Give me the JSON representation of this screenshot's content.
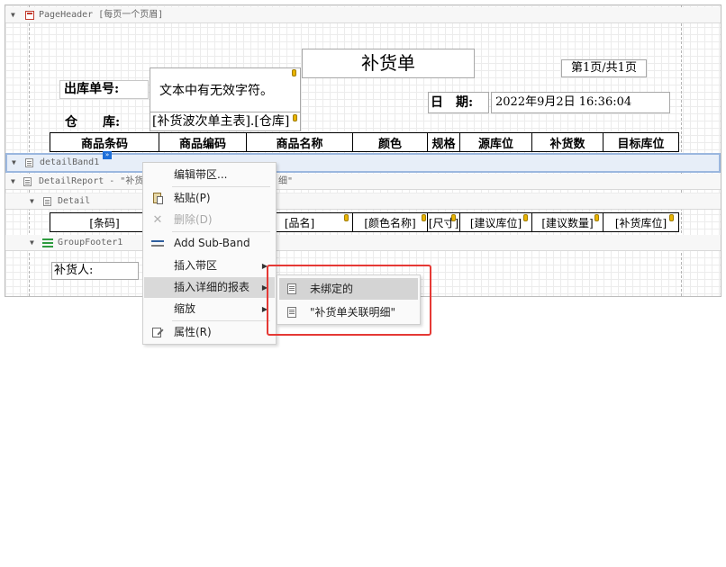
{
  "bands": {
    "page_header": "PageHeader [每页一个页眉]",
    "detail_band": "detailBand1",
    "detail_report": "DetailReport - \"补货单关联明细\"",
    "detail_report_visible": "DetailReport - \"补货",
    "detail_report_tail": "细\"",
    "detail": "Detail",
    "group_footer": "GroupFooter1"
  },
  "page_header": {
    "title": "补货单",
    "page_info": "第1页/共1页",
    "out_no_label": "出库单号:",
    "invalid_text": "文本中有无效字符。",
    "date_label": "日　期:",
    "date_value": "2022年9月2日 16:36:04",
    "warehouse_label": "仓　　库:",
    "warehouse_value": "[补货波次单主表].[仓库]"
  },
  "table_headers": [
    "商品条码",
    "商品编码",
    "商品名称",
    "颜色",
    "规格",
    "源库位",
    "补货数",
    "目标库位"
  ],
  "detail_cells": [
    "[条码]",
    "",
    "[品名]",
    "[颜色名称]",
    "[尺寸]",
    "[建议库位]",
    "[建议数量]",
    "[补货库位]"
  ],
  "footer": {
    "replenisher_label": "补货人:"
  },
  "context_menu": {
    "items": [
      {
        "label": "编辑带区...",
        "icon": "",
        "disabled": false,
        "submenu": false
      },
      {
        "label": "粘贴(P)",
        "icon": "paste-icon",
        "disabled": false,
        "submenu": false
      },
      {
        "label": "删除(D)",
        "icon": "delete-icon",
        "disabled": true,
        "submenu": false
      },
      {
        "label": "Add Sub-Band",
        "icon": "add-subband-icon",
        "disabled": false,
        "submenu": false
      },
      {
        "label": "插入带区",
        "icon": "",
        "disabled": false,
        "submenu": true
      },
      {
        "label": "插入详细的报表",
        "icon": "",
        "disabled": false,
        "submenu": true,
        "highlighted": true
      },
      {
        "label": "缩放",
        "icon": "",
        "disabled": false,
        "submenu": true
      },
      {
        "label": "属性(R)",
        "icon": "properties-icon",
        "disabled": false,
        "submenu": false
      }
    ]
  },
  "submenu": {
    "items": [
      {
        "label": "未绑定的",
        "highlighted": true
      },
      {
        "label": "\"补货单关联明细\"",
        "highlighted": false
      }
    ]
  },
  "colors": {
    "highlight_frame": "#e53935",
    "selected_band": "#9bb7df",
    "pin": "#e9b400"
  }
}
